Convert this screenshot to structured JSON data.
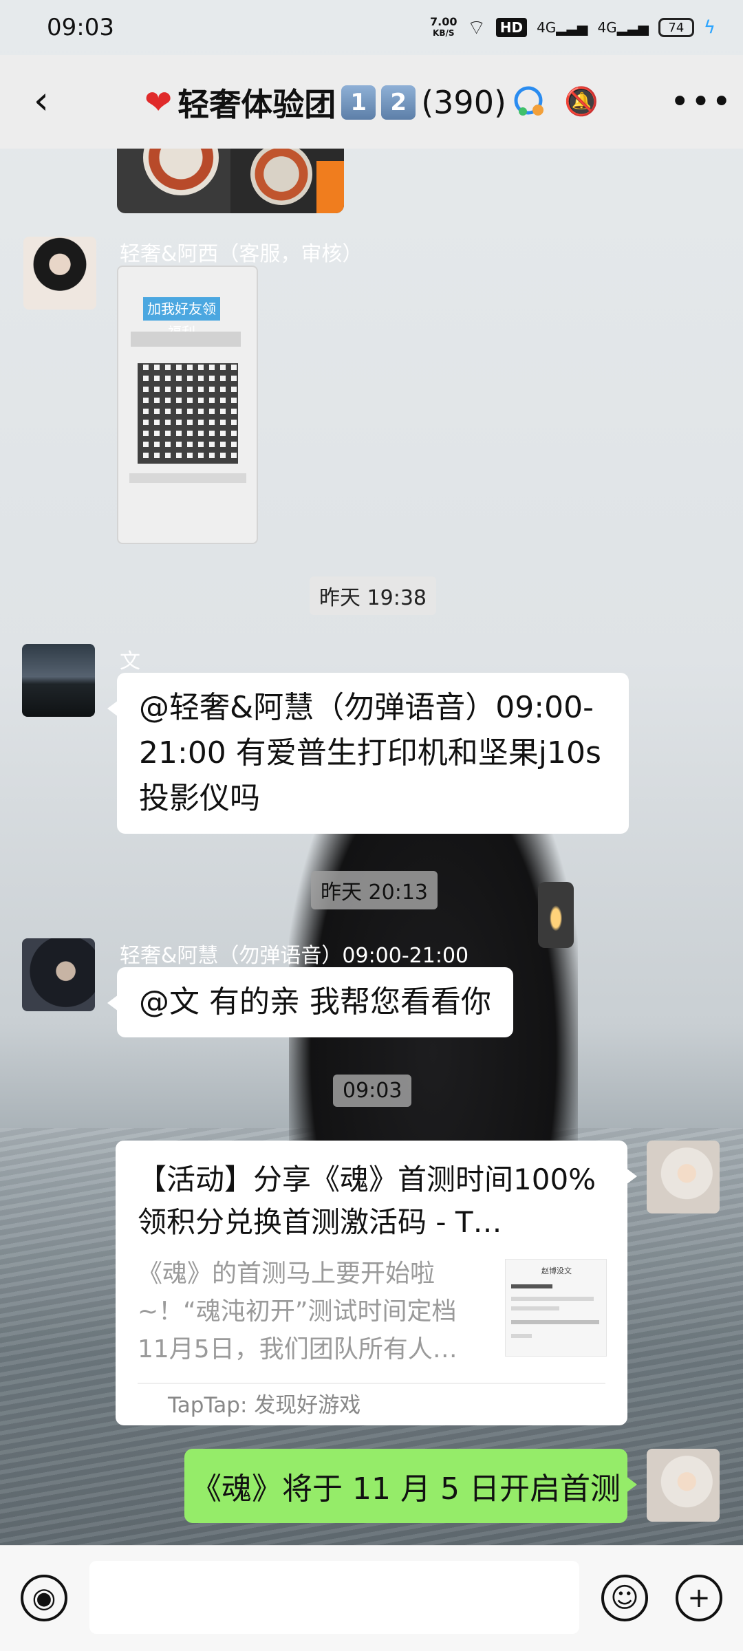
{
  "status_bar": {
    "time": "09:03",
    "net_speed_value": "7.00",
    "net_speed_unit": "KB/S",
    "hd_badge": "HD",
    "signal1": "4G",
    "signal2": "4G",
    "battery": "74"
  },
  "header": {
    "title": "轻奢体验团",
    "badge1": "1",
    "badge2": "2",
    "member_count": "(390)"
  },
  "messages": {
    "m1": {
      "sender": "轻奢&阿西（客服，审核）",
      "qr_header": "加我好友领福利"
    },
    "t1": "昨天 19:38",
    "m2": {
      "sender": "文",
      "text": "@轻奢&阿慧（勿弹语音）09:00-21:00 有爱普生打印机和坚果j10s投影仪吗"
    },
    "t2": "昨天 20:13",
    "m3": {
      "sender": "轻奢&阿慧（勿弹语音）09:00-21:00",
      "text": "@文 有的亲 我帮您看看你"
    },
    "t3": "09:03",
    "m4": {
      "title": "【活动】分享《魂》首测时间100%领积分兑换首测激活码 - T…",
      "desc": "《魂》的首测马上要开始啦~！“魂沌初开”测试时间定档11月5日，我们团队所有人…",
      "thumb_title": "赵博没文",
      "source": "TapTap: 发现好游戏"
    },
    "m5": {
      "text": "《魂》将于 11 月 5 日开启首测"
    }
  },
  "input": {
    "placeholder": ""
  },
  "colors": {
    "accent_green": "#95ec69",
    "header_bg": "#ededed"
  }
}
